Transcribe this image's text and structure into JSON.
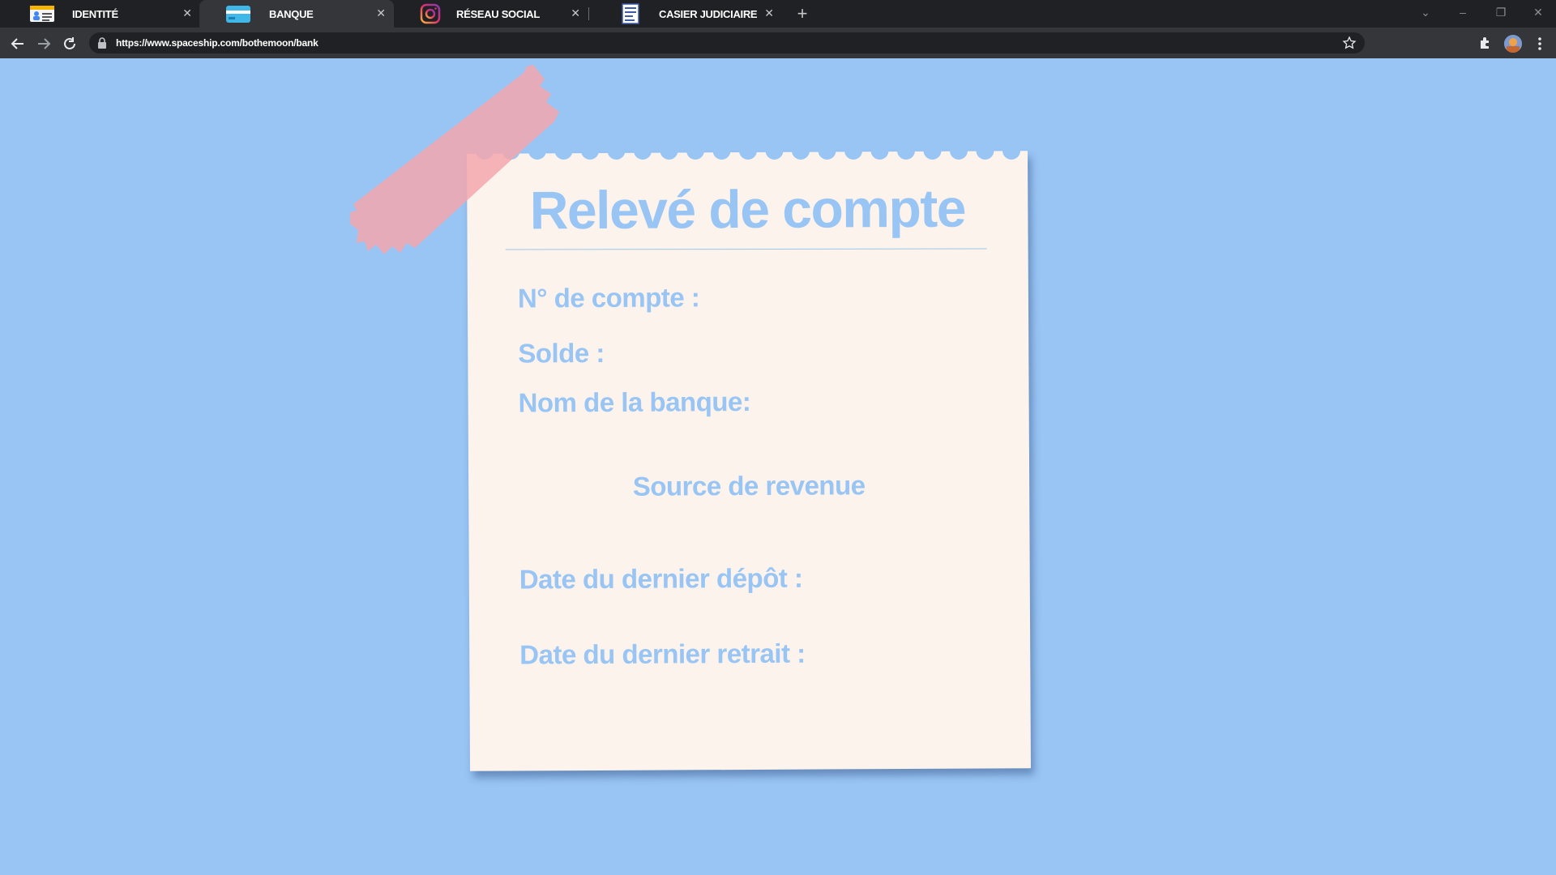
{
  "browser": {
    "tabs": [
      {
        "label": "IDENTITÉ",
        "icon": "id-card-icon"
      },
      {
        "label": "BANQUE",
        "icon": "bank-card-icon",
        "active": true
      },
      {
        "label": "RÉSEAU SOCIAL",
        "icon": "instagram-icon"
      },
      {
        "label": "CASIER JUDICIAIRE",
        "icon": "document-icon"
      }
    ],
    "url": "https://www.spaceship.com/bothemoon/bank"
  },
  "statement": {
    "title": "Relevé de compte",
    "account_number_label": "N° de compte :",
    "balance_label": "Solde :",
    "bank_name_label": "Nom de la banque:",
    "income_source_label": "Source de revenue",
    "last_deposit_label": "Date du dernier dépôt :",
    "last_withdrawal_label": "Date du dernier retrait :"
  },
  "colors": {
    "background": "#99c5f5",
    "paper": "#fbf3ec",
    "text": "#99c5f5",
    "tape": "#f3a6ae"
  }
}
